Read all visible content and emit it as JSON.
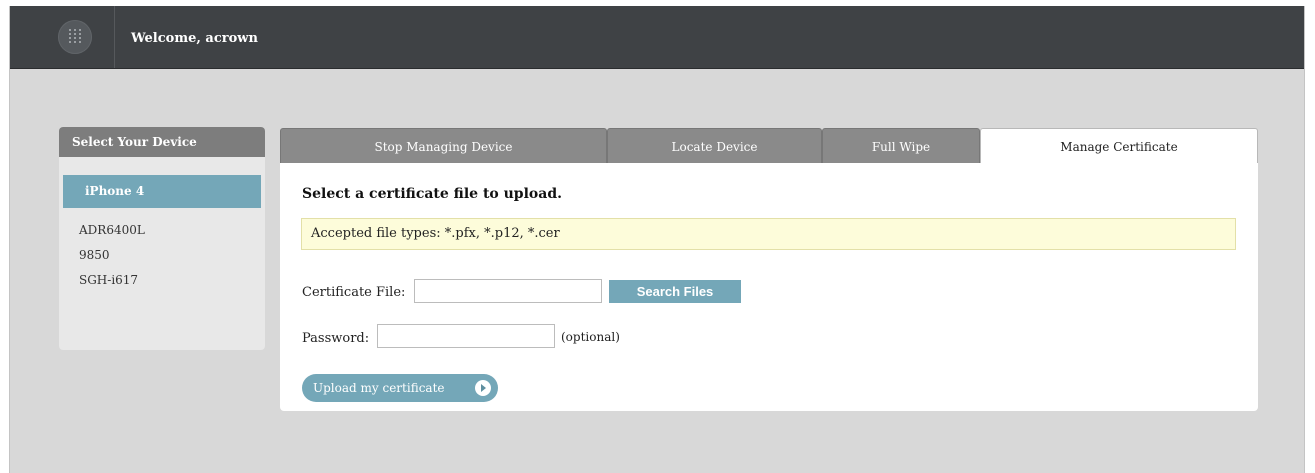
{
  "header": {
    "welcome_text": "Welcome, acrown",
    "logo_icon": "grid-dots-icon"
  },
  "sidebar": {
    "title": "Select Your Device",
    "selected": "iPhone 4",
    "devices": [
      {
        "label": "iPhone 4"
      },
      {
        "label": "ADR6400L"
      },
      {
        "label": "9850"
      },
      {
        "label": "SGH-i617"
      }
    ]
  },
  "tabs": [
    {
      "label": "Stop Managing Device"
    },
    {
      "label": "Locate Device"
    },
    {
      "label": "Full Wipe"
    },
    {
      "label": "Manage Certificate"
    }
  ],
  "active_tab": "Manage Certificate",
  "form": {
    "title": "Select a certificate file to upload.",
    "notice": "Accepted file types: *.pfx, *.p12, *.cer",
    "certificate_label": "Certificate File:",
    "certificate_value": "",
    "search_button": "Search Files",
    "password_label": "Password:",
    "password_value": "",
    "optional_note": "(optional)",
    "upload_button": "Upload my certificate",
    "upload_icon": "chevron-right-icon"
  },
  "colors": {
    "topbar": "#3f4245",
    "accent": "#74a7b8",
    "tab_inactive": "#8a8a8a",
    "notice_bg": "#fdfcda",
    "background": "#d8d8d8"
  }
}
